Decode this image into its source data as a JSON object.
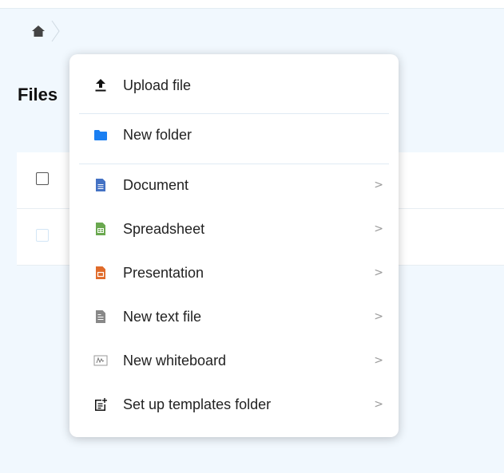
{
  "page": {
    "title": "Files"
  },
  "breadcrumb": {
    "home_icon": "home-icon"
  },
  "menu": {
    "items": [
      {
        "label": "Upload file",
        "icon": "upload-icon",
        "submenu": false
      },
      {
        "label": "New folder",
        "icon": "folder-icon",
        "submenu": false
      },
      {
        "label": "Document",
        "icon": "document-icon",
        "submenu": true,
        "chevron": ">"
      },
      {
        "label": "Spreadsheet",
        "icon": "spreadsheet-icon",
        "submenu": true,
        "chevron": ">"
      },
      {
        "label": "Presentation",
        "icon": "presentation-icon",
        "submenu": true,
        "chevron": ">"
      },
      {
        "label": "New text file",
        "icon": "text-file-icon",
        "submenu": true,
        "chevron": ">"
      },
      {
        "label": "New whiteboard",
        "icon": "whiteboard-icon",
        "submenu": true,
        "chevron": ">"
      },
      {
        "label": "Set up templates folder",
        "icon": "templates-icon",
        "submenu": true,
        "chevron": ">"
      }
    ]
  },
  "colors": {
    "background": "#f1f8fe",
    "folder": "#1a7ff2",
    "document": "#4472c4",
    "spreadsheet": "#6aa84f",
    "presentation": "#e06b2a",
    "textfile": "#888888"
  }
}
